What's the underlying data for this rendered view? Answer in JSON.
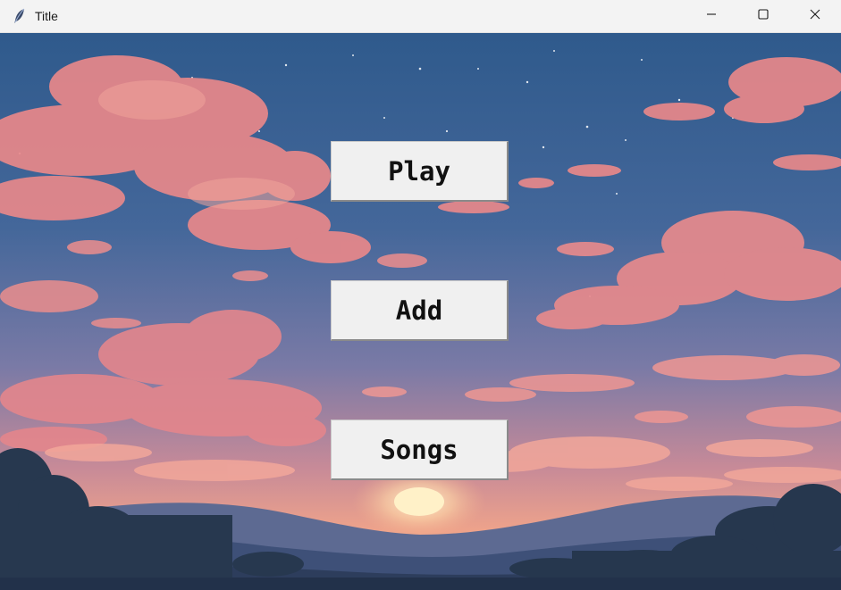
{
  "window": {
    "title": "Title",
    "app_icon": "feather-icon",
    "controls": {
      "minimize": "minimize-icon",
      "maximize": "maximize-icon",
      "close": "close-icon"
    }
  },
  "menu": {
    "play_label": "Play",
    "add_label": "Add",
    "songs_label": "Songs"
  },
  "colors": {
    "titlebar": "#f3f3f3",
    "button_face": "#f0f0f0",
    "sky_top": "#2f5a8c",
    "sky_bottom": "#f0a48a",
    "clouds": "#e88a86",
    "hills": "#3b4f72"
  }
}
